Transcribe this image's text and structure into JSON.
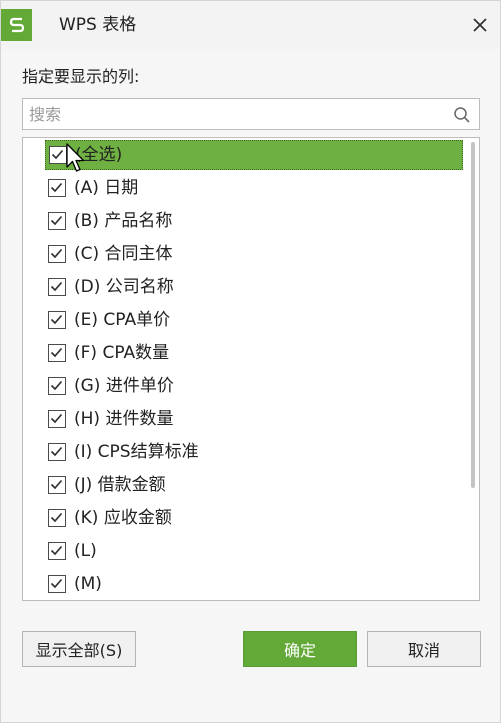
{
  "window": {
    "title": "WPS 表格",
    "brand_color": "#63a937"
  },
  "filter": {
    "label": "指定要显示的列:",
    "search_placeholder": "搜索",
    "items": [
      {
        "label": "(全选)",
        "checked": true,
        "selected": true
      },
      {
        "label": "(A) 日期",
        "checked": true
      },
      {
        "label": "(B) 产品名称",
        "checked": true
      },
      {
        "label": "(C) 合同主体",
        "checked": true
      },
      {
        "label": "(D) 公司名称",
        "checked": true
      },
      {
        "label": "(E) CPA单价",
        "checked": true
      },
      {
        "label": "(F) CPA数量",
        "checked": true
      },
      {
        "label": "(G) 进件单价",
        "checked": true
      },
      {
        "label": "(H) 进件数量",
        "checked": true
      },
      {
        "label": "(I) CPS结算标准",
        "checked": true
      },
      {
        "label": "(J) 借款金额",
        "checked": true
      },
      {
        "label": "(K) 应收金额",
        "checked": true
      },
      {
        "label": "(L)",
        "checked": true
      },
      {
        "label": "(M)",
        "checked": true
      }
    ]
  },
  "buttons": {
    "show_all": "显示全部(S)",
    "ok": "确定",
    "cancel": "取消"
  },
  "icons": {
    "app": "wps-spreadsheet-logo",
    "close": "close-icon",
    "search": "search-icon",
    "check": "check-icon",
    "cursor": "mouse-pointer-icon"
  }
}
